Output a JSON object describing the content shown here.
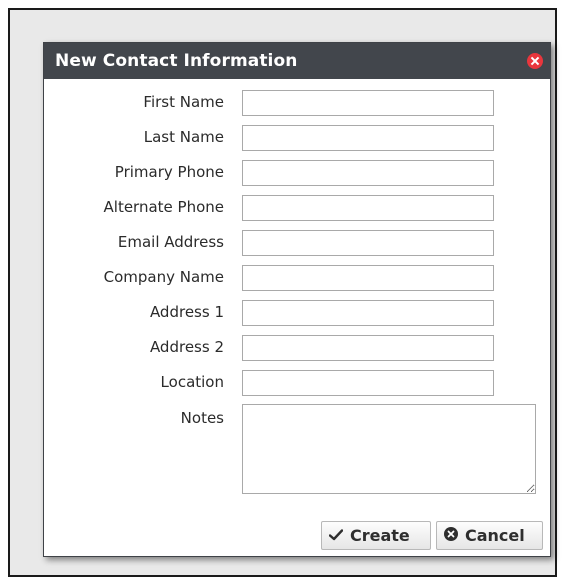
{
  "dialog": {
    "title": "New Contact Information",
    "close_icon": "close-circle-icon"
  },
  "fields": [
    {
      "label": "First Name",
      "value": ""
    },
    {
      "label": "Last Name",
      "value": ""
    },
    {
      "label": "Primary Phone",
      "value": ""
    },
    {
      "label": "Alternate Phone",
      "value": ""
    },
    {
      "label": "Email Address",
      "value": ""
    },
    {
      "label": "Company Name",
      "value": ""
    },
    {
      "label": "Address 1",
      "value": ""
    },
    {
      "label": "Address 2",
      "value": ""
    },
    {
      "label": "Location",
      "value": ""
    }
  ],
  "notes": {
    "label": "Notes",
    "value": ""
  },
  "buttons": {
    "create_label": "Create",
    "create_icon": "checkmark-icon",
    "cancel_label": "Cancel",
    "cancel_icon": "cancel-circle-icon"
  },
  "colors": {
    "titlebar": "#42464c",
    "close": "#e8363d",
    "background": "#e9e9e9"
  }
}
